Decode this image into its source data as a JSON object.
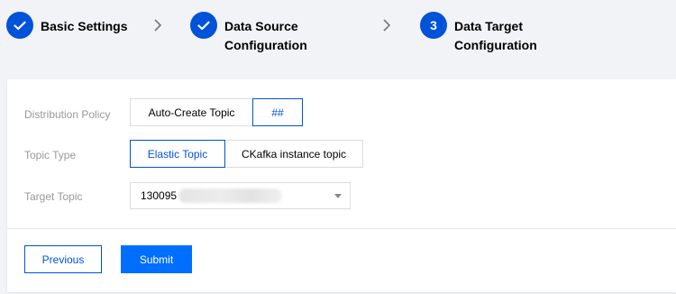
{
  "stepper": {
    "steps": [
      {
        "label_line1": "Basic Settings",
        "label_line2": "",
        "state": "done"
      },
      {
        "label_line1": "Data Source",
        "label_line2": "Configuration",
        "state": "done"
      },
      {
        "label_line1": "Data Target",
        "label_line2": "Configuration",
        "state": "current",
        "number": "3"
      }
    ],
    "accent_color": "#0052d9"
  },
  "form": {
    "distribution_policy": {
      "label": "Distribution Policy",
      "options": [
        "Auto-Create Topic",
        "##"
      ],
      "selected": "##"
    },
    "topic_type": {
      "label": "Topic Type",
      "options": [
        "Elastic Topic",
        "CKafka instance topic"
      ],
      "selected": "Elastic Topic"
    },
    "target_topic": {
      "label": "Target Topic",
      "value": "130095"
    }
  },
  "actions": {
    "previous_label": "Previous",
    "submit_label": "Submit",
    "submit_color": "#006eff"
  }
}
